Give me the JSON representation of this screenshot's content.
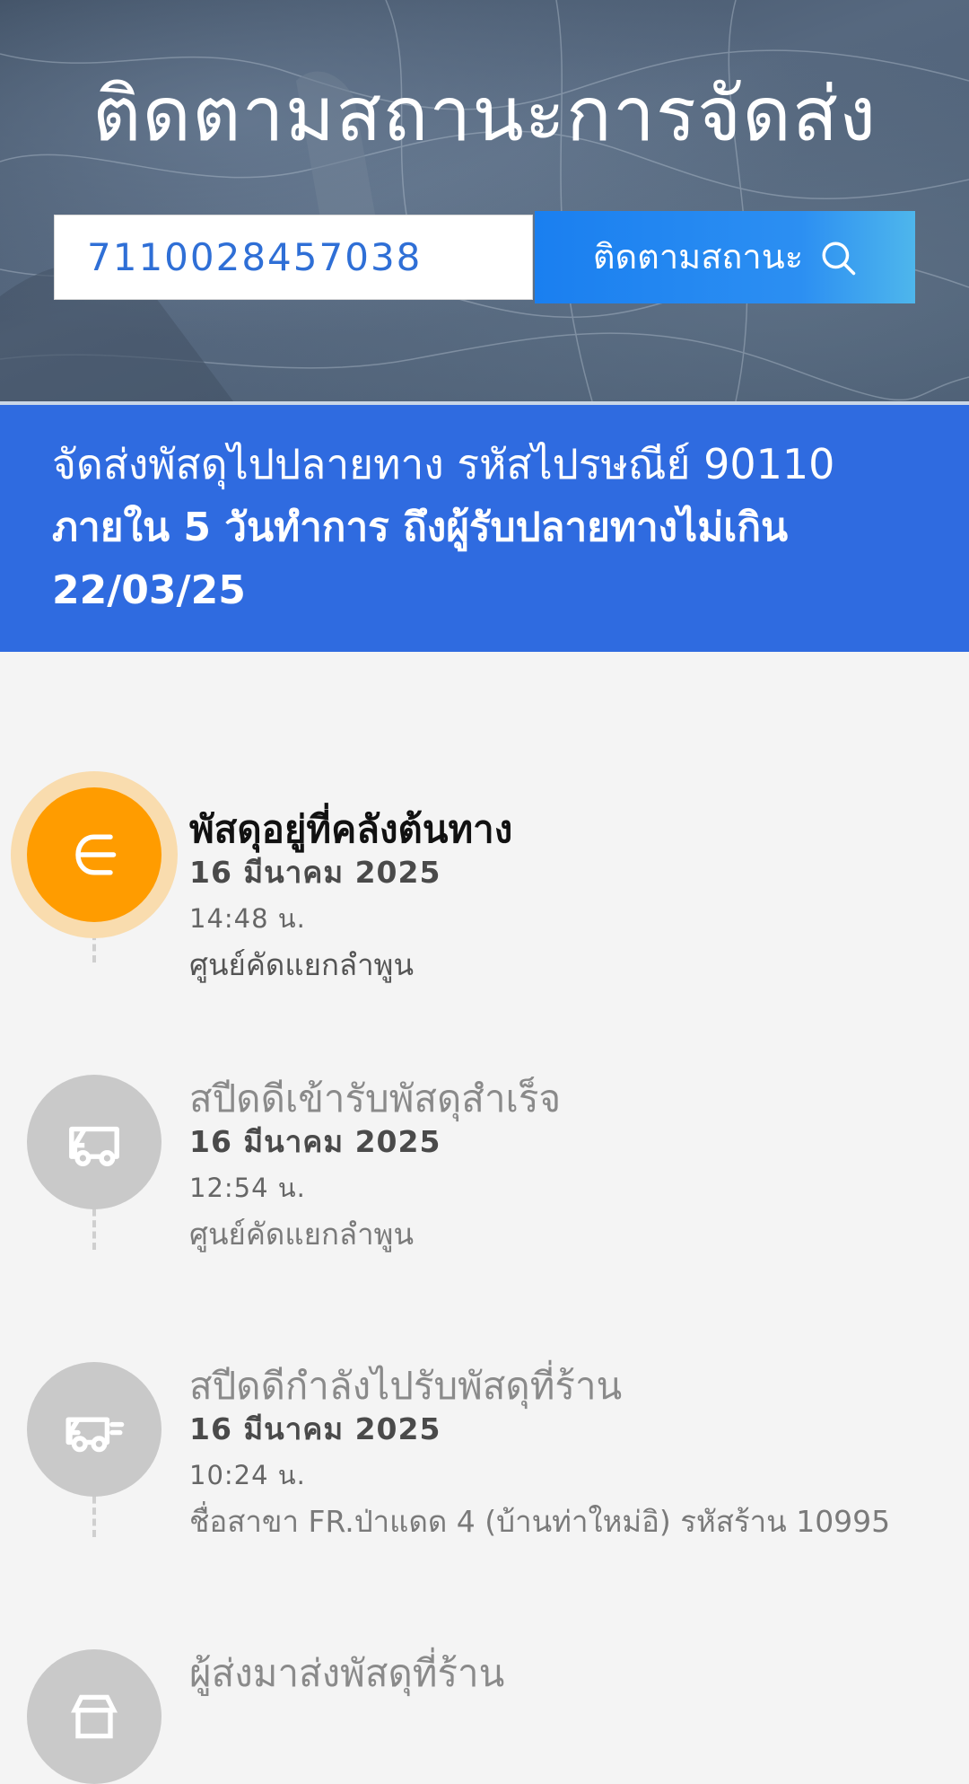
{
  "header": {
    "title": "ติดตามสถานะการจัดส่ง",
    "search_value": "7110028457038",
    "track_button_label": "ติดตามสถานะ"
  },
  "banner": {
    "line1": "จัดส่งพัสดุไปปลายทาง รหัสไปรษณีย์ 90110",
    "line2": "ภายใน 5 วันทำการ ถึงผู้รับปลายทางไม่เกิน 22/03/25"
  },
  "timeline": {
    "events": [
      {
        "title": "พัสดุอยู่ที่คลังต้นทาง",
        "date": "16 มีนาคม 2025",
        "time": "14:48 น.",
        "location": "ศูนย์คัดแยกลำพูน",
        "icon": "arrow-left-icon",
        "active": true
      },
      {
        "title": "สปีดดีเข้ารับพัสดุสำเร็จ",
        "date": "16 มีนาคม 2025",
        "time": "12:54 น.",
        "location": "ศูนย์คัดแยกลำพูน",
        "icon": "truck-icon",
        "active": false
      },
      {
        "title": "สปีดดีกำลังไปรับพัสดุที่ร้าน",
        "date": "16 มีนาคม 2025",
        "time": "10:24 น.",
        "location": "ชื่อสาขา FR.ป่าแดด 4 (บ้านท่าใหม่อิ) รหัสร้าน 10995",
        "icon": "moving-truck-icon",
        "active": false
      },
      {
        "title": "ผู้ส่งมาส่งพัสดุที่ร้าน",
        "icon": "store-icon",
        "active": false
      }
    ]
  },
  "colors": {
    "banner": "#2f6be0",
    "active_step": "#ff9c00",
    "inactive_step": "#c9c9c9",
    "input_text": "#2f6fd6"
  }
}
